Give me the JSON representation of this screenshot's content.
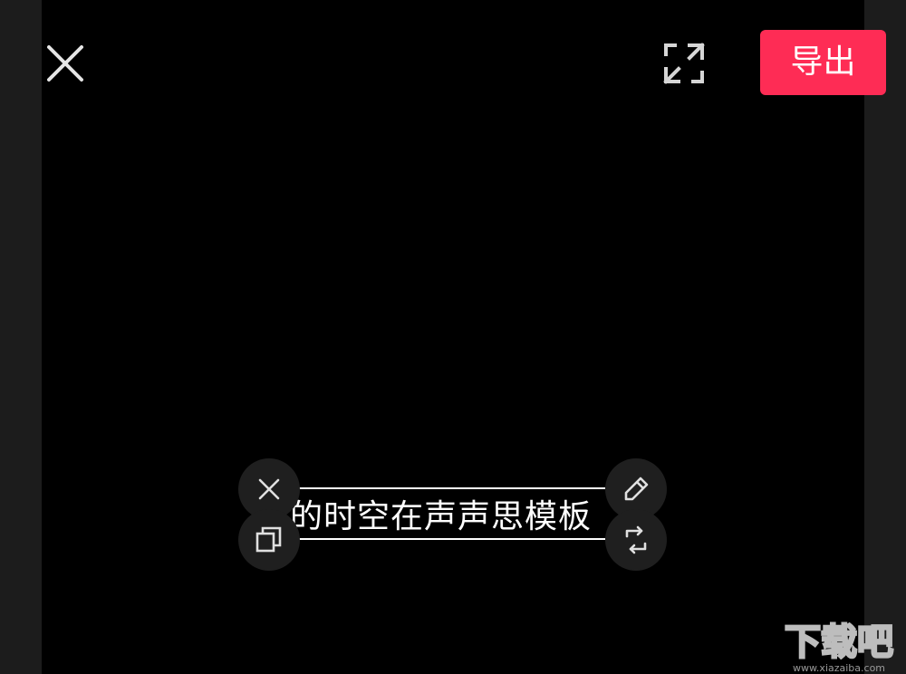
{
  "toolbar": {
    "close_icon": "close-icon",
    "fullscreen_icon": "fullscreen-icon",
    "export_label": "导出",
    "export_color": "#fe2c55"
  },
  "sticker": {
    "text": "的时空在声声思模板",
    "delete_icon": "close-icon",
    "copy_icon": "copy-icon",
    "edit_icon": "pencil-icon",
    "rotate_icon": "rotate-icon"
  },
  "watermark": {
    "logo": "下载吧",
    "url": "www.xiazaiba.com"
  }
}
